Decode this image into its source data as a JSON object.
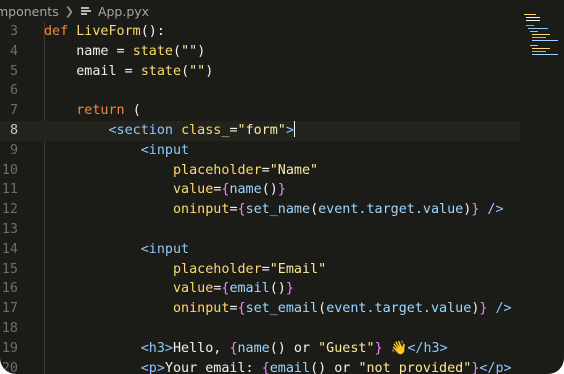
{
  "breadcrumb": {
    "folder": "mponents",
    "file": "App.pyx",
    "file_icon": "file-lines-icon"
  },
  "colors": {
    "background": "#1b1c17",
    "keyword": "#f7843d",
    "function": "#ffd86e",
    "string": "#ffe8a0",
    "tag": "#8fc5ff",
    "brace": "#e58bff",
    "line_number": "#6e6e66"
  },
  "editor": {
    "current_line": 8,
    "lines": [
      {
        "n": "3",
        "tokens": [
          [
            "kw",
            "def "
          ],
          [
            "fn",
            "LiveForm"
          ],
          [
            "plain",
            "():"
          ]
        ]
      },
      {
        "n": "4",
        "tokens": [
          [
            "plain",
            "    name = "
          ],
          [
            "fn",
            "state"
          ],
          [
            "plain",
            "("
          ],
          [
            "str",
            "\"\""
          ],
          [
            "plain",
            ")"
          ]
        ]
      },
      {
        "n": "5",
        "tokens": [
          [
            "plain",
            "    email = "
          ],
          [
            "fn",
            "state"
          ],
          [
            "plain",
            "("
          ],
          [
            "str",
            "\"\""
          ],
          [
            "plain",
            ")"
          ]
        ]
      },
      {
        "n": "6",
        "tokens": []
      },
      {
        "n": "7",
        "tokens": [
          [
            "kw",
            "    return "
          ],
          [
            "plain",
            "("
          ]
        ]
      },
      {
        "n": "8",
        "tokens": [
          [
            "tag",
            "        <section "
          ],
          [
            "attr",
            "class_"
          ],
          [
            "plain",
            "="
          ],
          [
            "str",
            "\"form\""
          ],
          [
            "tag",
            ">"
          ]
        ]
      },
      {
        "n": "9",
        "tokens": [
          [
            "tag",
            "            <input"
          ]
        ]
      },
      {
        "n": "10",
        "tokens": [
          [
            "attr",
            "                placeholder"
          ],
          [
            "plain",
            "="
          ],
          [
            "str",
            "\"Name\""
          ]
        ]
      },
      {
        "n": "11",
        "tokens": [
          [
            "attr",
            "                value"
          ],
          [
            "plain",
            "="
          ],
          [
            "brace",
            "{"
          ],
          [
            "var",
            "name"
          ],
          [
            "plain",
            "()"
          ],
          [
            "brace",
            "}"
          ]
        ]
      },
      {
        "n": "12",
        "tokens": [
          [
            "attr",
            "                oninput"
          ],
          [
            "plain",
            "="
          ],
          [
            "brace",
            "{"
          ],
          [
            "var",
            "set_name"
          ],
          [
            "plain",
            "("
          ],
          [
            "var",
            "event.target.value"
          ],
          [
            "plain",
            ")"
          ],
          [
            "brace",
            "}"
          ],
          [
            "tag",
            " />"
          ]
        ]
      },
      {
        "n": "13",
        "tokens": []
      },
      {
        "n": "14",
        "tokens": [
          [
            "tag",
            "            <input"
          ]
        ]
      },
      {
        "n": "15",
        "tokens": [
          [
            "attr",
            "                placeholder"
          ],
          [
            "plain",
            "="
          ],
          [
            "str",
            "\"Email\""
          ]
        ]
      },
      {
        "n": "16",
        "tokens": [
          [
            "attr",
            "                value"
          ],
          [
            "plain",
            "="
          ],
          [
            "brace",
            "{"
          ],
          [
            "var",
            "email"
          ],
          [
            "plain",
            "()"
          ],
          [
            "brace",
            "}"
          ]
        ]
      },
      {
        "n": "17",
        "tokens": [
          [
            "attr",
            "                oninput"
          ],
          [
            "plain",
            "="
          ],
          [
            "brace",
            "{"
          ],
          [
            "var",
            "set_email"
          ],
          [
            "plain",
            "("
          ],
          [
            "var",
            "event.target.value"
          ],
          [
            "plain",
            ")"
          ],
          [
            "brace",
            "}"
          ],
          [
            "tag",
            " />"
          ]
        ]
      },
      {
        "n": "18",
        "tokens": []
      },
      {
        "n": "19",
        "tokens": [
          [
            "tag",
            "            <h3>"
          ],
          [
            "plain",
            "Hello, "
          ],
          [
            "brace",
            "{"
          ],
          [
            "var",
            "name"
          ],
          [
            "plain",
            "() or "
          ],
          [
            "str",
            "\"Guest\""
          ],
          [
            "brace",
            "}"
          ],
          [
            "plain",
            " 👋"
          ],
          [
            "tag",
            "</h3>"
          ]
        ]
      },
      {
        "n": "20",
        "tokens": [
          [
            "tag",
            "            <p>"
          ],
          [
            "plain",
            "Your email: "
          ],
          [
            "brace",
            "{"
          ],
          [
            "var",
            "email"
          ],
          [
            "plain",
            "() or "
          ],
          [
            "str",
            "\"not provided\""
          ],
          [
            "brace",
            "}"
          ],
          [
            "tag",
            "</p>"
          ]
        ]
      }
    ]
  }
}
